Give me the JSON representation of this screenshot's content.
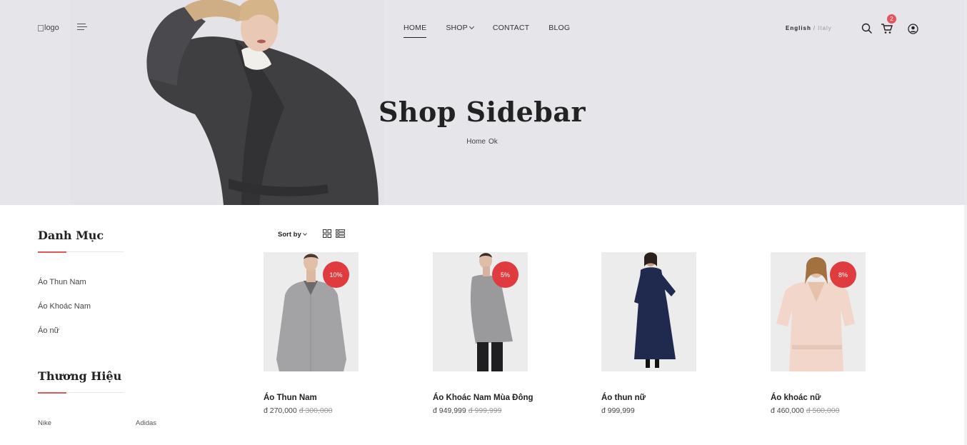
{
  "header": {
    "logo_alt": "logo",
    "nav": [
      {
        "label": "HOME"
      },
      {
        "label": "SHOP"
      },
      {
        "label": "CONTACT"
      },
      {
        "label": "BLOG"
      }
    ],
    "language": {
      "current": "English",
      "separator": "/",
      "alternate": "Italy"
    },
    "cart_count": "2"
  },
  "hero": {
    "title": "Shop Sidebar",
    "breadcrumb": [
      "Home",
      "Ok"
    ]
  },
  "sidebar": {
    "categories_title": "Danh Mục",
    "categories": [
      "Áo Thun Nam",
      "Áo Khoác Nam",
      "Áo nữ"
    ],
    "brands_title": "Thương Hiệu",
    "brands": [
      "Nike",
      "Adidas"
    ]
  },
  "toolbar": {
    "sort_label": "Sort by"
  },
  "products": [
    {
      "name": "Áo Thun Nam",
      "price": "đ 270,000",
      "old_price": "đ 300,000",
      "discount": "10%"
    },
    {
      "name": "Áo Khoác Nam Mùa Đông",
      "price": "đ 949,999",
      "old_price": "đ 999,999",
      "discount": "5%"
    },
    {
      "name": "Áo thun nữ",
      "price": "đ 999,999",
      "old_price": "",
      "discount": ""
    },
    {
      "name": "Áo khoác nữ",
      "price": "đ 460,000",
      "old_price": "đ 500,000",
      "discount": "8%"
    }
  ],
  "colors": {
    "accent": "#e2565b",
    "badge": "#e03c3f",
    "hero_bg": "#e6e5ea"
  }
}
